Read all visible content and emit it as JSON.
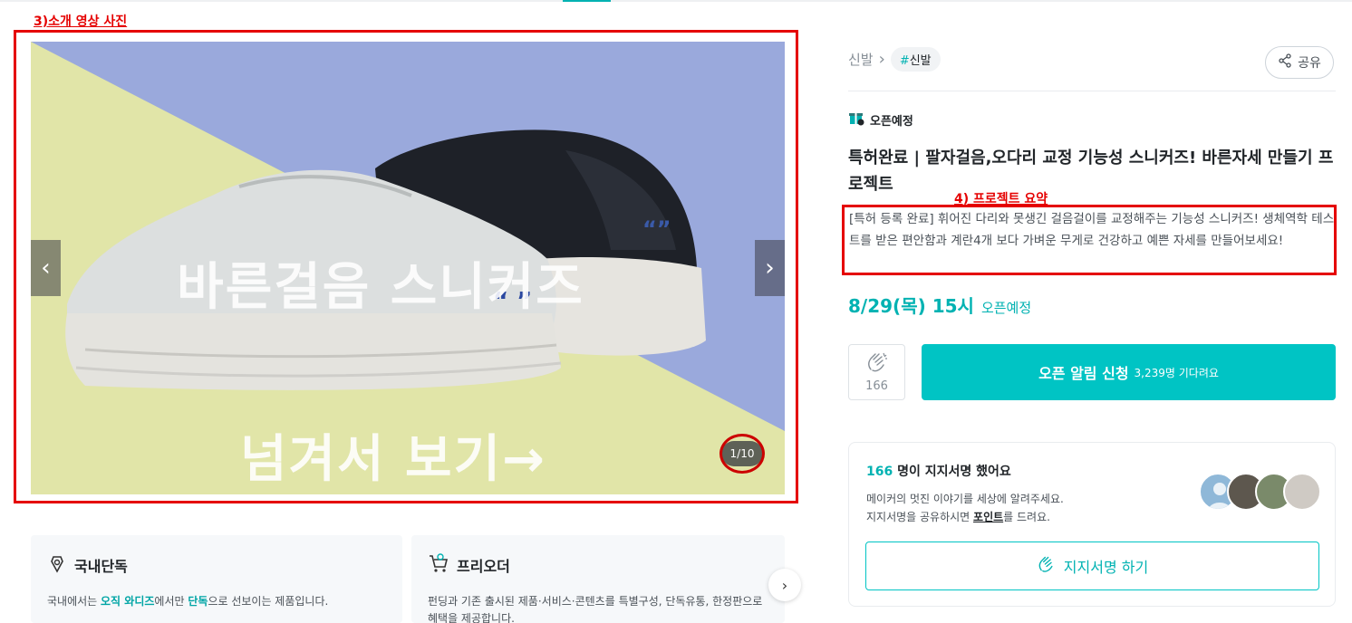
{
  "annotations": {
    "photo_label": "3)소개 영상 사진",
    "summary_label": "4) 프로젝트 요약"
  },
  "hero": {
    "title_line1": "바른걸음 스니커즈",
    "title_line2": "넘겨서 보기→",
    "counter": "1/10",
    "prev_icon": "chevron-left-icon",
    "next_icon": "chevron-right-icon"
  },
  "features": [
    {
      "icon": "domestic-exclusive-icon",
      "title": "국내단독",
      "desc_parts": [
        "국내에서는 ",
        "오직 와디즈",
        "에서만 ",
        "단독",
        "으로 선보이는 제품입니다."
      ]
    },
    {
      "icon": "cart-icon",
      "title": "프리오더",
      "desc": "펀딩과 기존 출시된 제품·서비스·콘텐츠를 특별구성, 단독유통, 한정판으로 혜택을 제공합니다."
    }
  ],
  "breadcrumb": {
    "category": "신발",
    "tag": "신발"
  },
  "share": {
    "label": "공유"
  },
  "status": {
    "label": "오픈예정"
  },
  "project": {
    "title": "특허완료 | 팔자걸음,오다리 교정 기능성 스니커즈! 바른자세 만들기 프로젝트",
    "summary": "[특허 등록 완료] 휘어진 다리와 못생긴 걸음걸이를 교정해주는 기능성 스니커즈! 생체역학 테스트를 받은 편안함과 계란4개 보다 가벼운 무게로 건강하고 예쁜 자세를 만들어보세요!"
  },
  "open": {
    "date": "8/29(목) 15시",
    "status": "오픈예정"
  },
  "like": {
    "count": "166"
  },
  "notify": {
    "label": "오픈 알림 신청",
    "waiting": "3,239명 기다려요"
  },
  "support": {
    "count": "166",
    "head_suffix": " 명이 지지서명 했어요",
    "line1": "메이커의 멋진 이야기를 세상에 알려주세요.",
    "line2_pre": "지지서명을 공유하시면 ",
    "line2_bold": "포인트",
    "line2_post": "를 드려요.",
    "button": "지지서명 하기"
  },
  "colors": {
    "accent": "#00c4c4",
    "annotation": "#e50000"
  }
}
